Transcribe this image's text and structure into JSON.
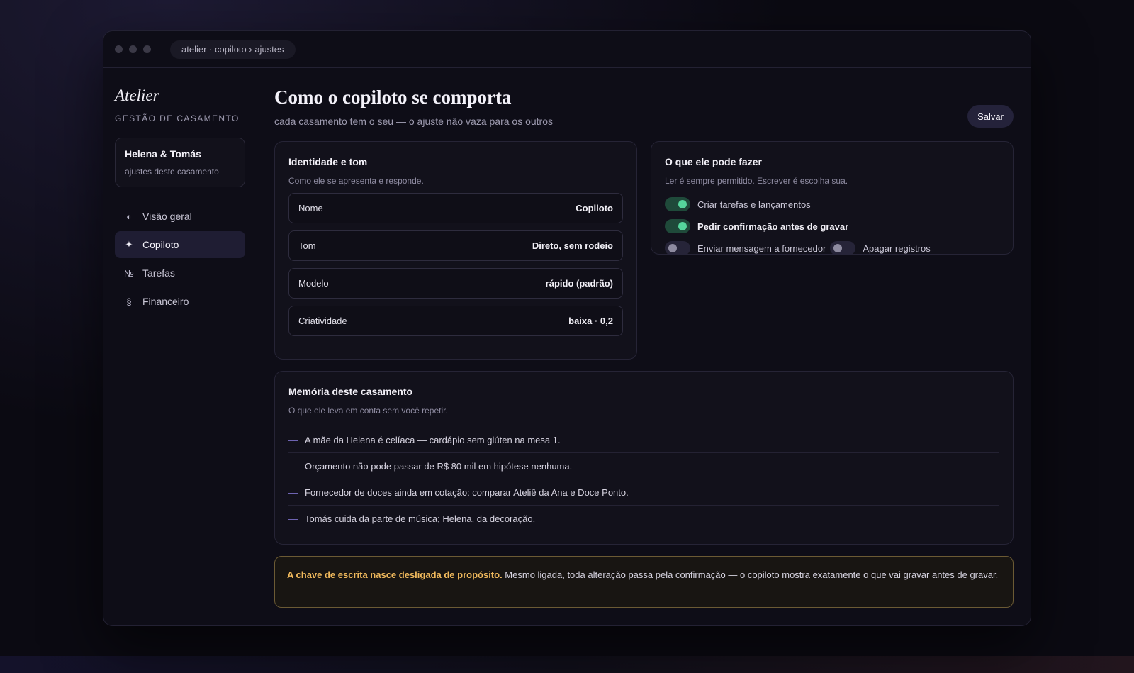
{
  "browser": {
    "address": "atelier · copiloto › ajustes"
  },
  "sidebar": {
    "brand": "Atelier",
    "brand_sub": "GESTÃO DE CASAMENTO",
    "wedding": {
      "name": "Helena & Tomás",
      "sub": "ajustes deste casamento"
    },
    "items": [
      {
        "label": "Visão geral",
        "icon": "◐",
        "icon_name": "half-circle-icon",
        "active": false
      },
      {
        "label": "Copiloto",
        "icon": "✦",
        "icon_name": "sparkle-icon",
        "active": true
      },
      {
        "label": "Tarefas",
        "icon": "№",
        "icon_name": "numero-icon",
        "active": false
      },
      {
        "label": "Financeiro",
        "icon": "§",
        "icon_name": "section-sign-icon",
        "active": false
      }
    ]
  },
  "header": {
    "title": "Como o copiloto se comporta",
    "subtitle": "cada casamento tem o seu — o ajuste não vaza para os outros",
    "save_label": "Salvar"
  },
  "identity": {
    "title": "Identidade e tom",
    "subtitle": "Como ele se apresenta e responde.",
    "fields": [
      {
        "label": "Nome",
        "value": "Copiloto"
      },
      {
        "label": "Tom",
        "value": "Direto, sem rodeio"
      },
      {
        "label": "Modelo",
        "value": "rápido (padrão)"
      },
      {
        "label": "Criatividade",
        "value": "baixa · 0,2"
      }
    ]
  },
  "permissions": {
    "title": "O que ele pode fazer",
    "subtitle": "Ler é sempre permitido. Escrever é escolha sua.",
    "toggles": [
      {
        "label": "Criar tarefas e lançamentos",
        "on": true,
        "strong": false
      },
      {
        "label": "Pedir confirmação antes de gravar",
        "on": true,
        "strong": true
      },
      {
        "label": "Enviar mensagem a fornecedor",
        "on": false,
        "strong": false
      },
      {
        "label": "Apagar registros",
        "on": false,
        "strong": false
      }
    ]
  },
  "memory": {
    "title": "Memória deste casamento",
    "subtitle": "O que ele leva em conta sem você repetir.",
    "dash": "—",
    "items": [
      "A mãe da Helena é celíaca — cardápio sem glúten na mesa 1.",
      "Orçamento não pode passar de R$ 80 mil em hipótese nenhuma.",
      "Fornecedor de doces ainda em cotação: comparar Ateliê da Ana e Doce Ponto.",
      "Tomás cuida da parte de música; Helena, da decoração."
    ]
  },
  "notice": {
    "strong": "A chave de escrita nasce desligada de propósito.",
    "text": " Mesmo ligada, toda alteração passa pela confirmação — o copiloto mostra exatamente o que vai gravar antes de gravar."
  },
  "colors": {
    "accent_on": "#55d69c",
    "warning": "#f0b95c",
    "active_nav": "#1f1d33"
  }
}
